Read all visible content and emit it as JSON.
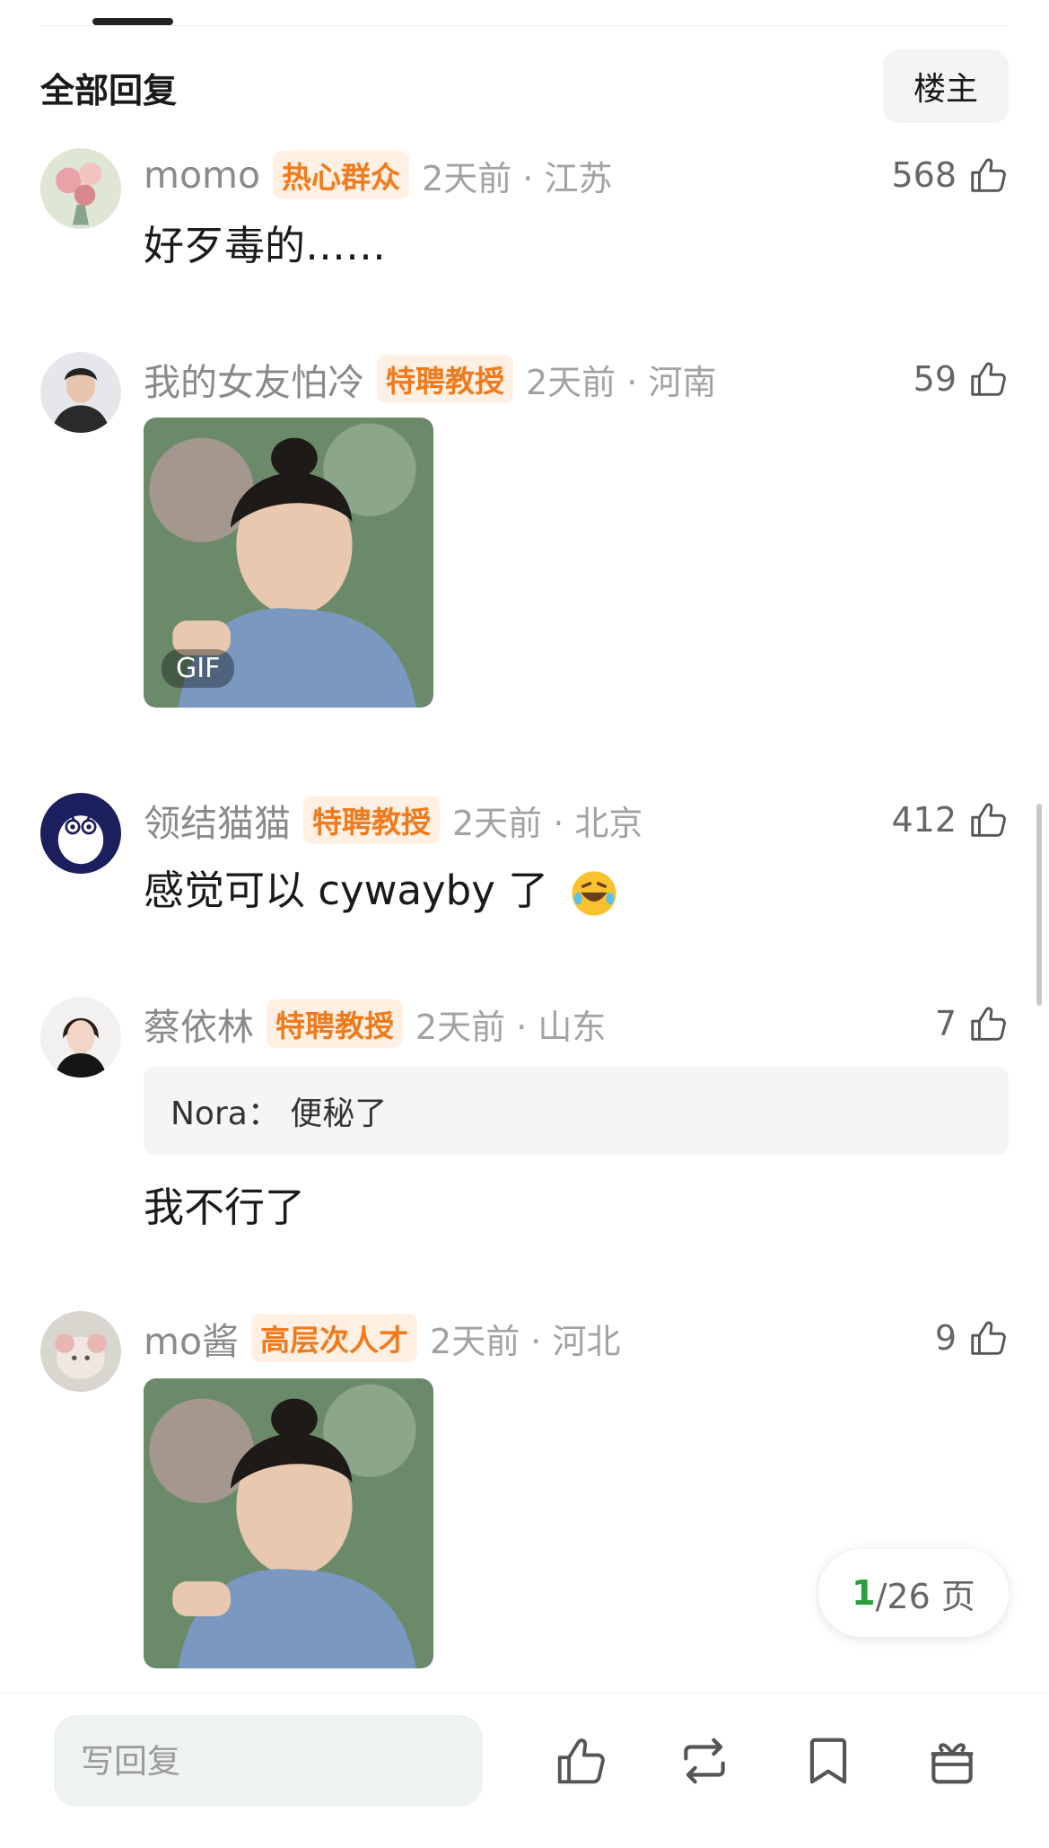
{
  "header": {
    "title": "全部回复",
    "op_filter_label": "楼主"
  },
  "comments": [
    {
      "username": "momo",
      "badge": "热心群众",
      "time_location": "2天前 · 江苏",
      "likes": "568",
      "text": "好歹毒的……"
    },
    {
      "username": "我的女友怕冷",
      "badge": "特聘教授",
      "time_location": "2天前 · 河南",
      "likes": "59",
      "image_label": "GIF"
    },
    {
      "username": "领结猫猫",
      "badge": "特聘教授",
      "time_location": "2天前 · 北京",
      "likes": "412",
      "text": "感觉可以 cywayby 了"
    },
    {
      "username": "蔡依林",
      "badge": "特聘教授",
      "time_location": "2天前 · 山东",
      "likes": "7",
      "quote": "Nora：  便秘了",
      "text": "我不行了"
    },
    {
      "username": "mo酱",
      "badge": "高层次人才",
      "time_location": "2天前 · 河北",
      "likes": "9"
    }
  ],
  "pagination": {
    "current": "1",
    "rest": "/26 页"
  },
  "bottom_bar": {
    "reply_placeholder": "写回复"
  },
  "colors": {
    "badge_bg": "#fff0e3",
    "badge_text": "#f07a1c",
    "page_accent": "#2a9d3e",
    "input_bg": "#eef3ef"
  },
  "icons": [
    "thumbs-up-icon",
    "repost-icon",
    "bookmark-icon",
    "gift-icon",
    "laughing-emoji-icon"
  ]
}
